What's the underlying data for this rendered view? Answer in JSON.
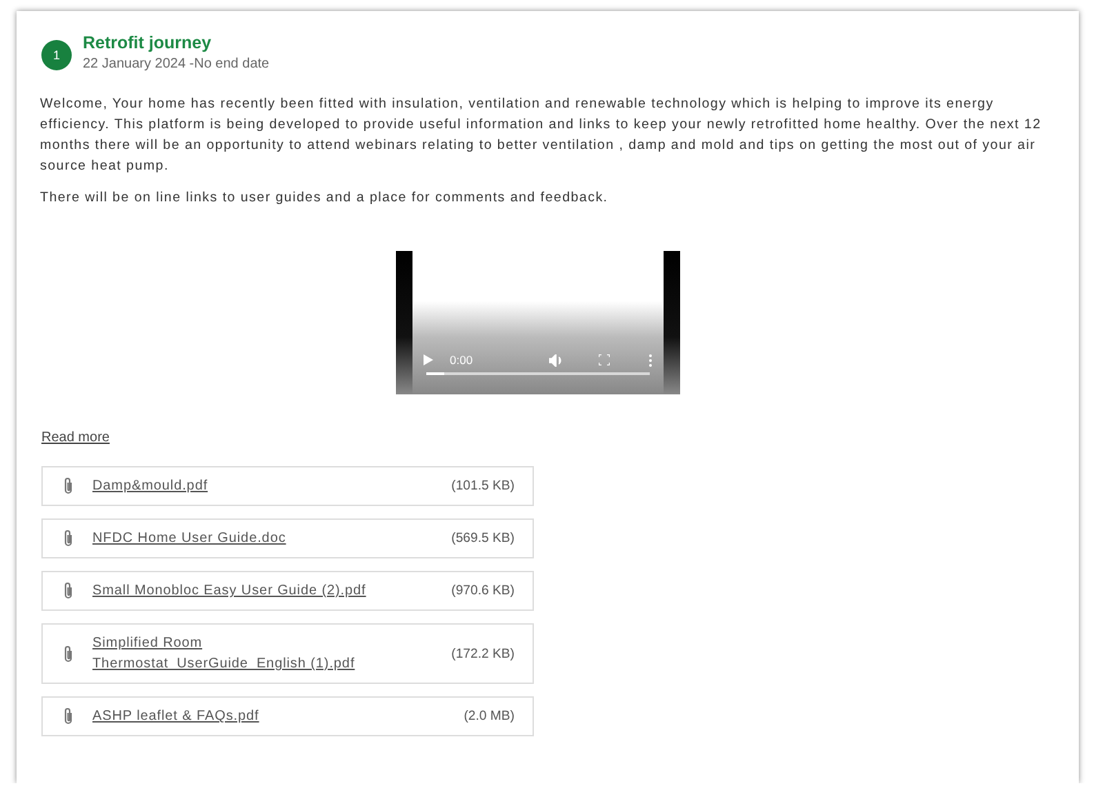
{
  "event": {
    "number": "1",
    "title": "Retrofit journey",
    "dates": "22 January 2024 -No end date"
  },
  "paragraphs": [
    "Welcome, Your home has recently been fitted with insulation, ventilation and renewable technology which is helping to improve its energy efficiency. This platform is being developed to provide useful information and links to keep your newly retrofitted home healthy. Over the next 12 months there will be an opportunity to attend webinars relating to better ventilation , damp and mold and tips on getting the most out of your air source heat pump.",
    "There will be on line links to user guides and a place for comments and feedback."
  ],
  "video": {
    "time": "0:00",
    "level": 0.08
  },
  "read_more": "Read more",
  "attachments": [
    {
      "name": "Damp&mould.pdf",
      "size": "(101.5 KB)"
    },
    {
      "name": "NFDC Home User Guide.doc",
      "size": "(569.5 KB)"
    },
    {
      "name": "Small Monobloc Easy User Guide (2).pdf",
      "size": "(970.6 KB)"
    },
    {
      "name": "Simplified Room Thermostat_UserGuide_English (1).pdf",
      "size": "(172.2 KB)"
    },
    {
      "name": "ASHP leaflet & FAQs.pdf",
      "size": "(2.0 MB)"
    }
  ]
}
